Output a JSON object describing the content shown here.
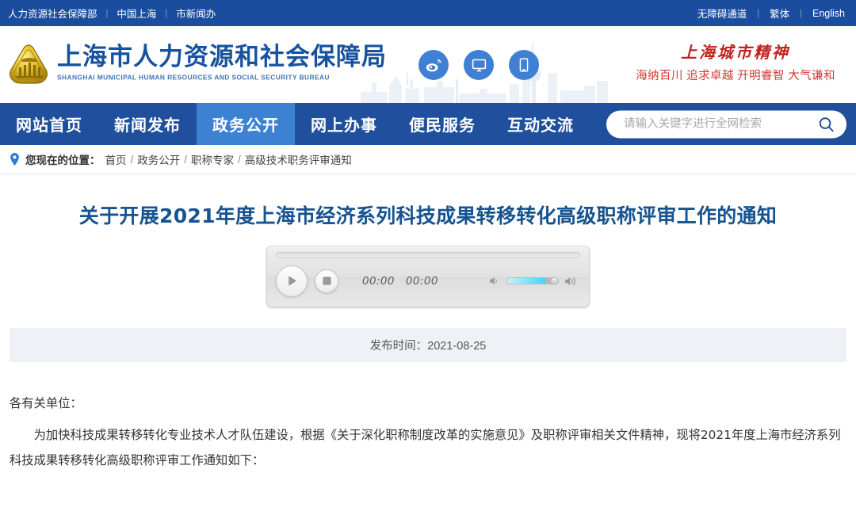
{
  "topbar": {
    "left_links": [
      "人力资源社会保障部",
      "中国上海",
      "市新闻办"
    ],
    "right_links": [
      "无障碍通道",
      "繁体",
      "English"
    ],
    "background": "#1a4d9e"
  },
  "masthead": {
    "brand_cn": "上海市人力资源和社会保障局",
    "brand_en": "SHANGHAI MUNICIPAL HUMAN RESOURCES AND SOCIAL SECURITY BUREAU",
    "brand_color": "#17529f",
    "logo_icon": "golden-triangle-emblem",
    "social": [
      {
        "name": "weibo-icon",
        "label": "微博"
      },
      {
        "name": "desktop-icon",
        "label": "电脑版"
      },
      {
        "name": "mobile-icon",
        "label": "手机版"
      }
    ],
    "social_color": "#3f7fd4",
    "spirit_title": "上海城市精神",
    "spirit_slogan": "海纳百川 追求卓越 开明睿智 大气谦和",
    "spirit_color": "#c0221e"
  },
  "nav": {
    "items": [
      {
        "label": "网站首页",
        "active": false
      },
      {
        "label": "新闻发布",
        "active": false
      },
      {
        "label": "政务公开",
        "active": true
      },
      {
        "label": "网上办事",
        "active": false
      },
      {
        "label": "便民服务",
        "active": false
      },
      {
        "label": "互动交流",
        "active": false
      }
    ],
    "background": "#1f4f9d",
    "active_background": "#3d82d2"
  },
  "search": {
    "placeholder": "请输入关键字进行全网检索",
    "value": "",
    "icon": "search-icon"
  },
  "breadcrumb": {
    "pin_icon": "location-pin-icon",
    "label": "您现在的位置：",
    "items": [
      "首页",
      "政务公开",
      "职称专家",
      "高级技术职务评审通知"
    ],
    "separator": "/"
  },
  "article": {
    "title": "关于开展2021年度上海市经济系列科技成果转移转化高级职称评审工作的通知",
    "title_color": "#16538f",
    "publish_label": "发布时间：2021-08-25",
    "paragraphs": [
      "各有关单位：",
      "为加快科技成果转移转化专业技术人才队伍建设，根据《关于深化职称制度改革的实施意见》及职称评审相关文件精神，现将2021年度上海市经济系列科技成果转移转化高级职称评审工作通知如下："
    ]
  },
  "player": {
    "play_icon": "play-icon",
    "stop_icon": "stop-icon",
    "current_time": "00:00",
    "total_time": "00:00",
    "volume_low_icon": "volume-low-icon",
    "volume_high_icon": "volume-high-icon",
    "volume_percent": 75,
    "seek_percent": 0,
    "volume_color": "#3ed8fb"
  }
}
